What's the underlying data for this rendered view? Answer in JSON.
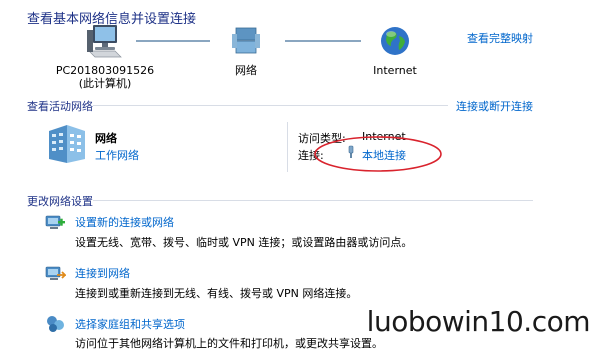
{
  "header": {
    "title": "查看基本网络信息并设置连接",
    "full_map_link": "查看完整映射"
  },
  "map": {
    "computer": {
      "name": "PC201803091526",
      "sub": "(此计算机)"
    },
    "network": {
      "name": "网络"
    },
    "internet": {
      "name": "Internet"
    }
  },
  "active": {
    "heading": "查看活动网络",
    "connect_link": "连接或断开连接",
    "network_name": "网络",
    "network_type_link": "工作网络",
    "access_type_label": "访问类型:",
    "access_type_value": "Internet",
    "connections_label": "连接:",
    "connection_link": "本地连接"
  },
  "change": {
    "heading": "更改网络设置",
    "tasks": [
      {
        "title": "设置新的连接或网络",
        "desc": "设置无线、宽带、拨号、临时或 VPN 连接；或设置路由器或访问点。"
      },
      {
        "title": "连接到网络",
        "desc": "连接到或重新连接到无线、有线、拨号或 VPN 网络连接。"
      },
      {
        "title": "选择家庭组和共享选项",
        "desc": "访问位于其他网络计算机上的文件和打印机，或更改共享设置。"
      }
    ]
  },
  "watermark": "luobowin10.com",
  "colors": {
    "link": "#0066cc",
    "title": "#1e3287",
    "highlight_ellipse": "#d9232d"
  }
}
